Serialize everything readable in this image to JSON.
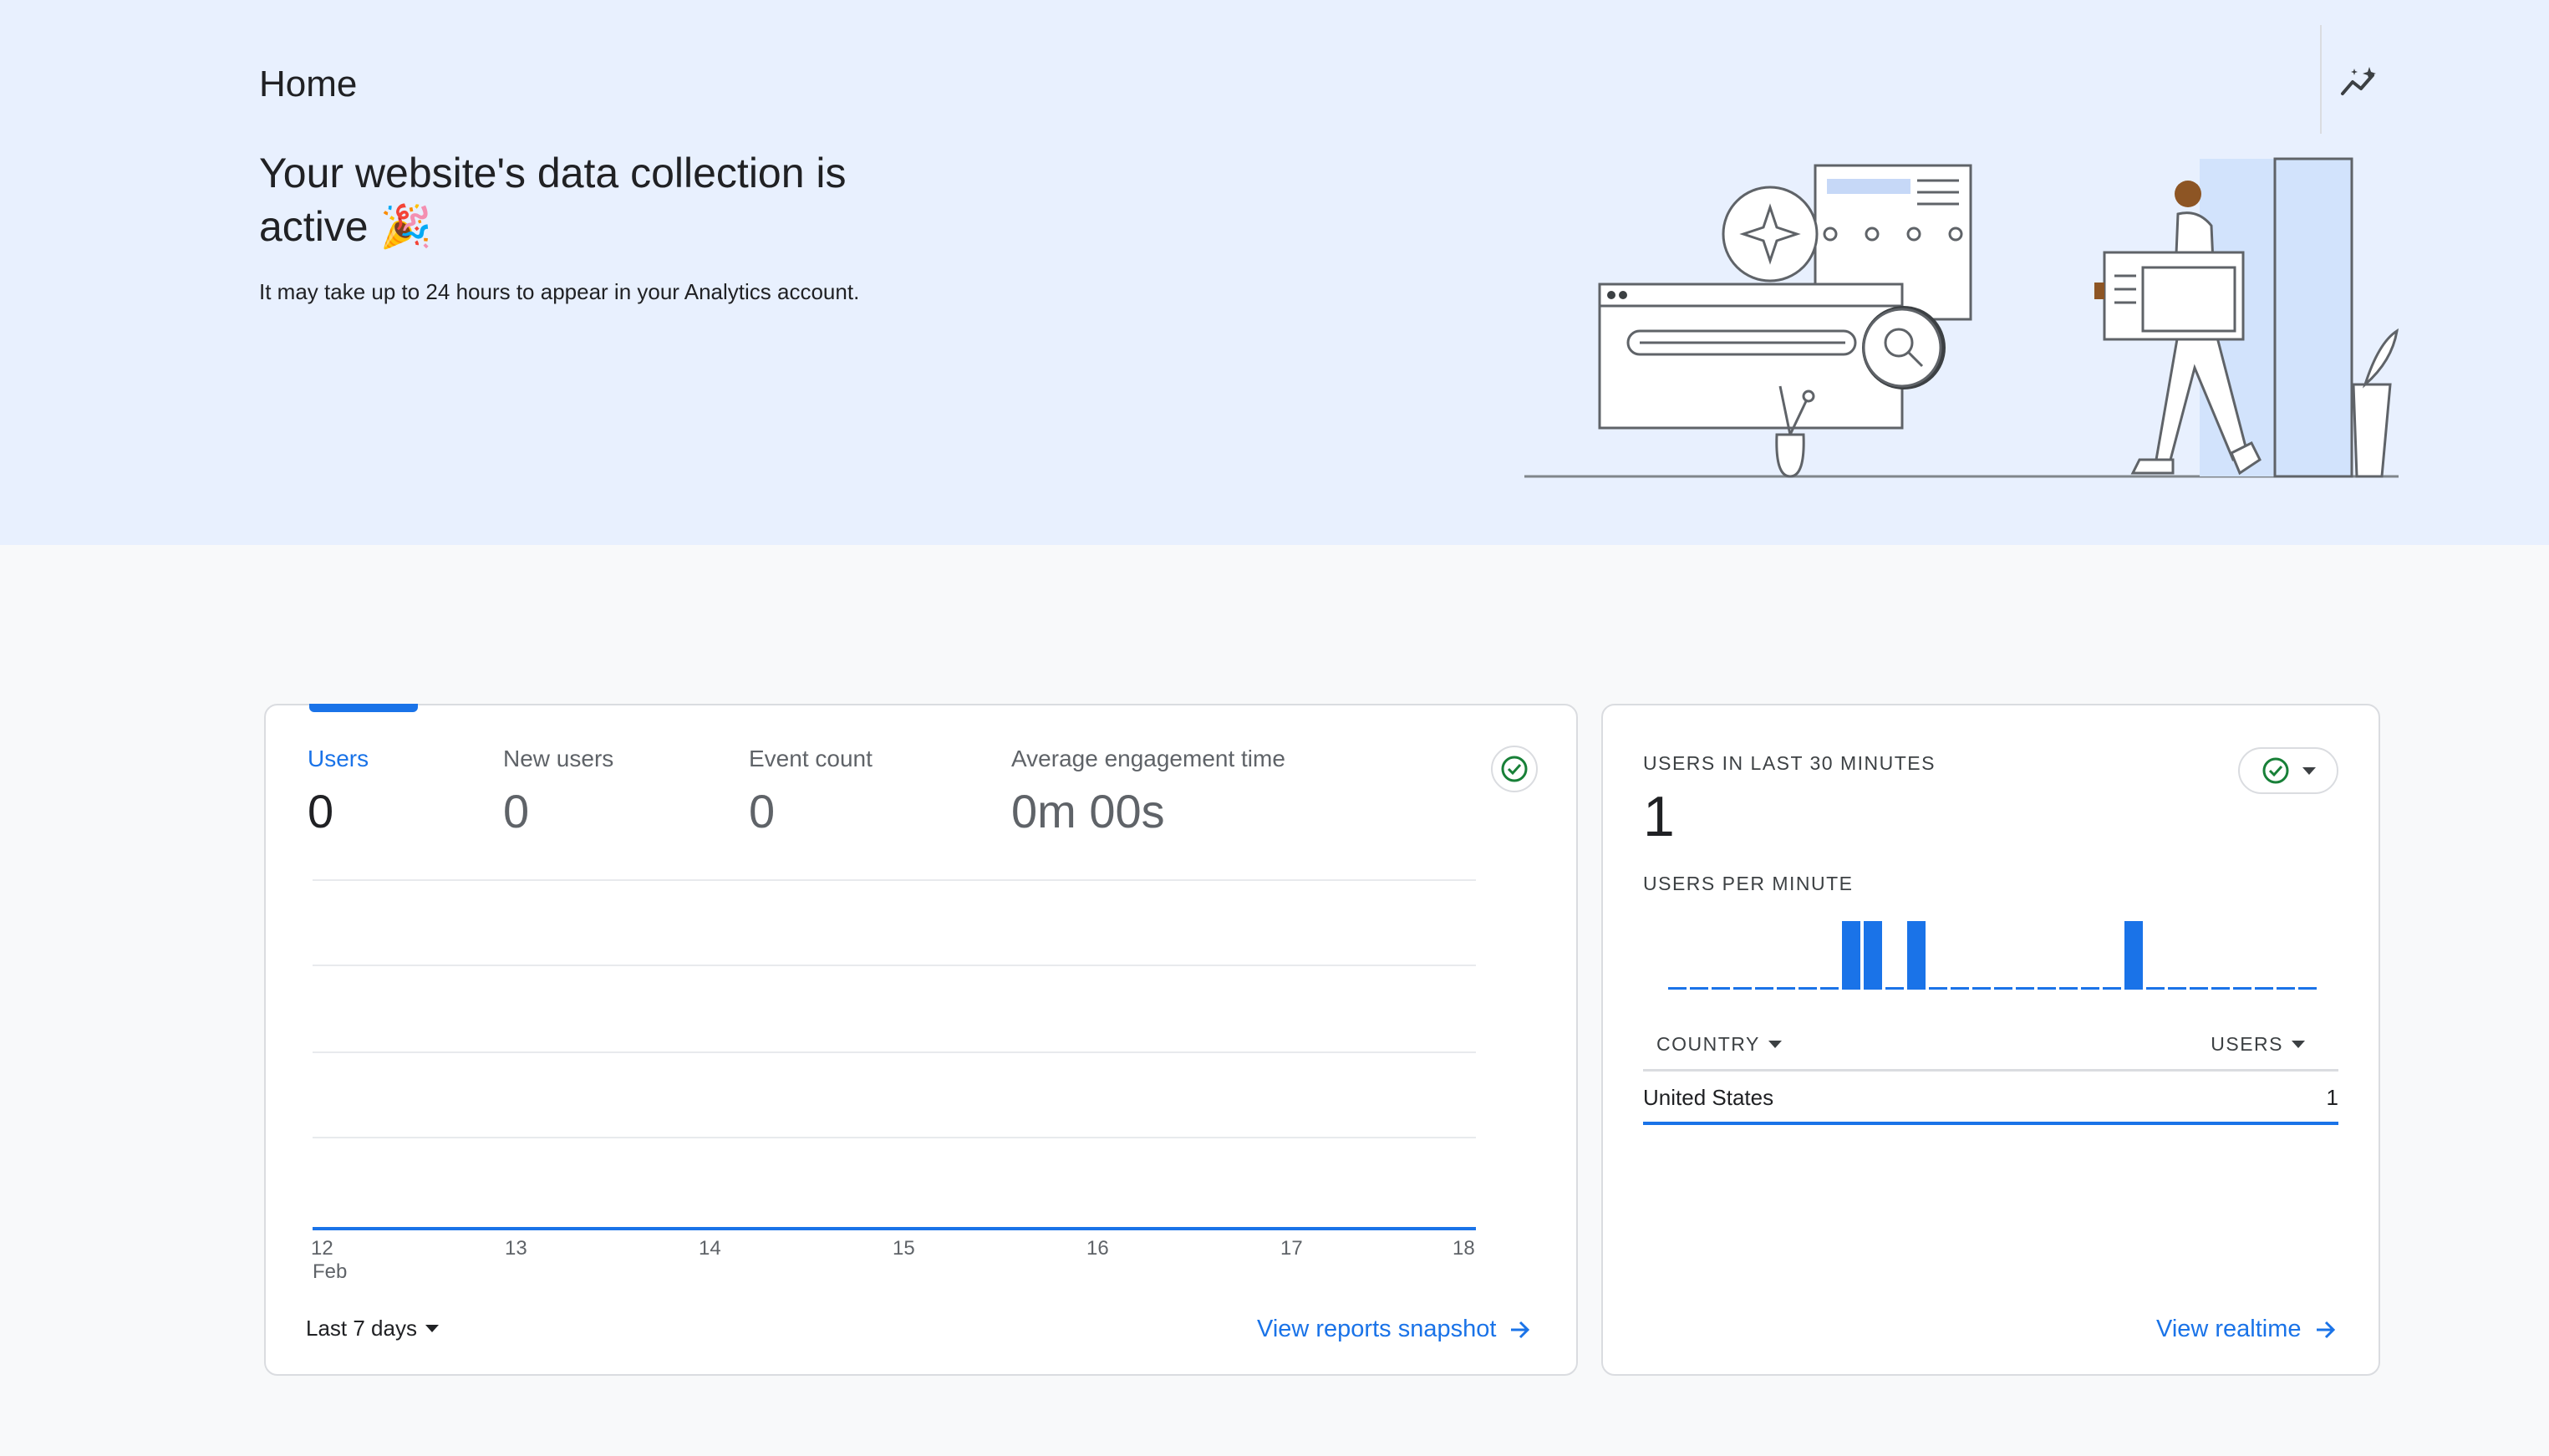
{
  "header": {
    "title": "Home",
    "insights_icon": "insights-sparkle-icon"
  },
  "hero": {
    "heading": "Your website's data collection is active 🎉",
    "subtext": "It may take up to 24 hours to appear in your Analytics account."
  },
  "overview_card": {
    "metrics": [
      {
        "label": "Users",
        "value": "0",
        "active": true
      },
      {
        "label": "New users",
        "value": "0",
        "active": false
      },
      {
        "label": "Event count",
        "value": "0",
        "active": false
      },
      {
        "label": "Average engagement time",
        "value": "0m 00s",
        "active": false
      }
    ],
    "status_icon": "check-circle-icon",
    "date_range_label": "Last 7 days",
    "link_label": "View reports snapshot"
  },
  "chart_data": {
    "type": "line",
    "x": [
      "12",
      "13",
      "14",
      "15",
      "16",
      "17",
      "18"
    ],
    "x_sub_first": "Feb",
    "series": [
      {
        "values": [
          0,
          0,
          0,
          0,
          0,
          0,
          0
        ]
      }
    ],
    "grid": true
  },
  "realtime_card": {
    "title": "USERS IN LAST 30 MINUTES",
    "count": "1",
    "subtitle": "USERS PER MINUTE",
    "per_minute": [
      0,
      0,
      0,
      0,
      0,
      0,
      0,
      0,
      1,
      1,
      0,
      1,
      0,
      0,
      0,
      0,
      0,
      0,
      0,
      0,
      0,
      1,
      0,
      0,
      0,
      0,
      0,
      0,
      0,
      0
    ],
    "columns": [
      {
        "label": "COUNTRY"
      },
      {
        "label": "USERS"
      }
    ],
    "rows": [
      {
        "country": "United States",
        "users": "1"
      }
    ],
    "link_label": "View realtime"
  },
  "colors": {
    "accent": "#1a73e8",
    "hero_bg": "#e8f0fe",
    "success": "#188038"
  }
}
